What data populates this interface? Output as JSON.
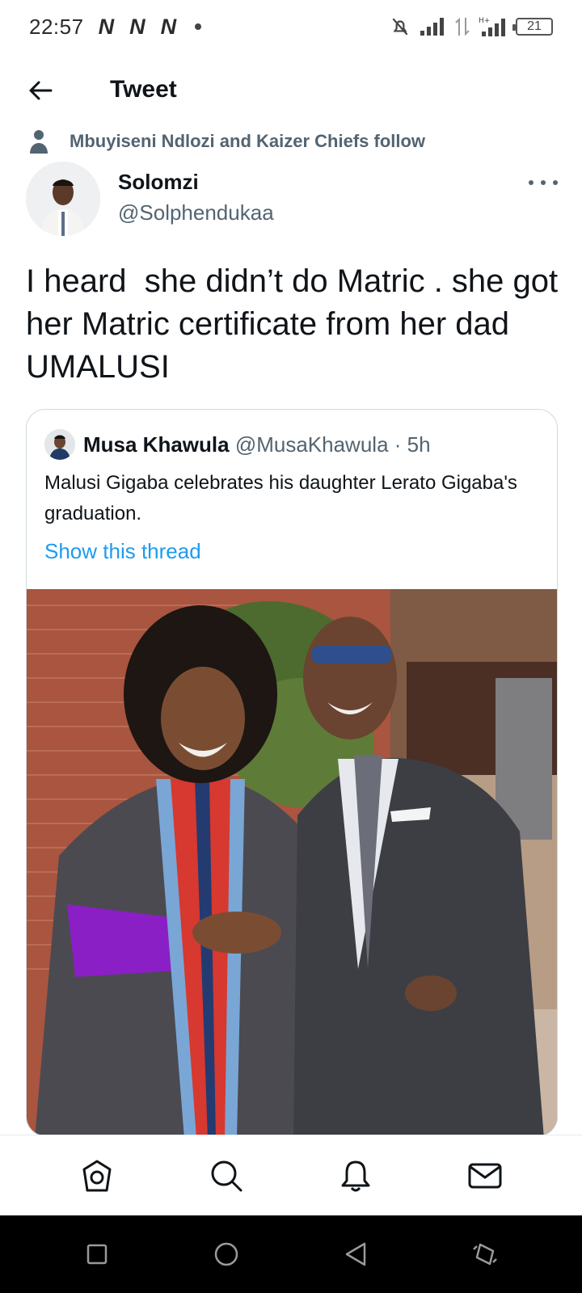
{
  "status_bar": {
    "time": "22:57",
    "notification_icons": [
      "N",
      "N",
      "N"
    ],
    "battery": "21"
  },
  "header": {
    "title": "Tweet"
  },
  "social_context": {
    "text": "Mbuyiseni Ndlozi and Kaizer Chiefs follow"
  },
  "author": {
    "name": "Solomzi",
    "handle": "@Solphendukaa"
  },
  "tweet": {
    "text": "I heard  she didn’t do Matric . she got her Matric certificate from her dad  UMALUSI"
  },
  "quote": {
    "name": "Musa Khawula",
    "handle": "@MusaKhawula",
    "separator": " · ",
    "time": "5h",
    "text": "Malusi Gigaba celebrates his daughter Lerato Gigaba's graduation.",
    "thread_link": "Show this thread",
    "link_color": "#1d9bf0"
  },
  "bottom_nav": {
    "items": [
      "home-icon",
      "search-icon",
      "bell-icon",
      "mail-icon"
    ]
  },
  "system_nav": {
    "items": [
      "square-icon",
      "circle-icon",
      "back-triangle-icon",
      "rotate-icon"
    ]
  }
}
